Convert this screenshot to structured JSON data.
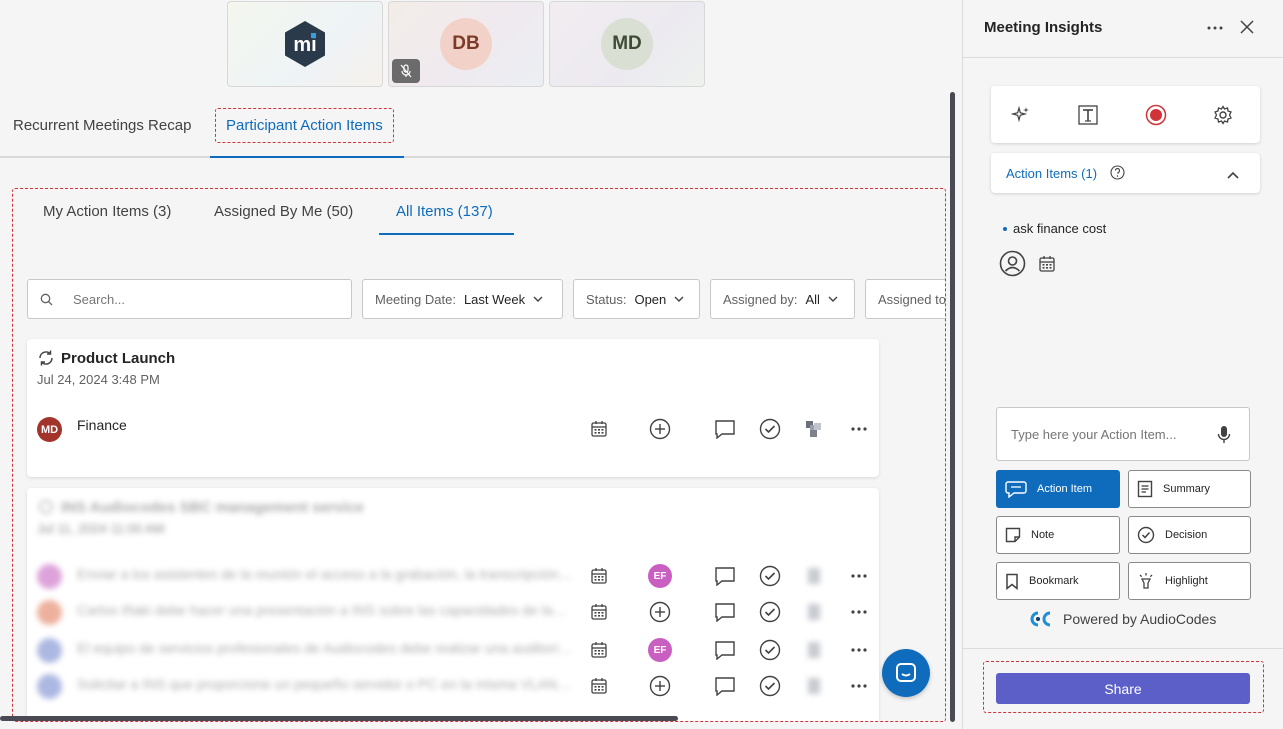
{
  "participants": {
    "tile2_initials": "DB",
    "tile3_initials": "MD"
  },
  "top_tabs": {
    "recap": "Recurrent Meetings Recap",
    "participant_items": "Participant Action Items"
  },
  "sub_tabs": {
    "mine": "My Action Items (3)",
    "assigned_by_me": "Assigned By Me (50)",
    "all": "All Items (137)"
  },
  "filters": {
    "search_placeholder": "Search...",
    "meeting_date_label": "Meeting Date:",
    "meeting_date_value": "Last Week",
    "status_label": "Status:",
    "status_value": "Open",
    "assigned_by_label": "Assigned by:",
    "assigned_by_value": "All",
    "assigned_to_label": "Assigned to"
  },
  "cards": [
    {
      "title": "Product Launch",
      "date": "Jul 24, 2024 3:48 PM",
      "rows": [
        {
          "initials": "MD",
          "text": "Finance"
        }
      ]
    },
    {
      "title": "INS Audiocodes SBC management service",
      "date": "Jul 11, 2024 11:00 AM",
      "rows": [
        {
          "initials": "",
          "text": "Enviar a los asistentes de la reunión el acceso a la grabación, la transcripción…",
          "assignee": "EF"
        },
        {
          "initials": "",
          "text": "Carlos Iñaki debe hacer una presentación a INS sobre las capacidades de la…",
          "assignee": ""
        },
        {
          "initials": "",
          "text": "El equipo de servicios profesionales de Audiocodes debe realizar una auditorí…",
          "assignee": "EF"
        },
        {
          "initials": "",
          "text": "Solicitar a INS que proporcione un pequeño servidor o PC en la misma VLAN…",
          "assignee": ""
        }
      ]
    }
  ],
  "panel": {
    "title": "Meeting Insights",
    "action_items_header": "Action Items (1)",
    "item_text": "ask finance cost",
    "type_placeholder": "Type here your Action Item...",
    "buttons": {
      "action_item": "Action Item",
      "summary": "Summary",
      "note": "Note",
      "decision": "Decision",
      "bookmark": "Bookmark",
      "highlight": "Highlight"
    },
    "powered_by": "Powered by AudioCodes",
    "share": "Share"
  },
  "colors": {
    "accent": "#0f6cbd",
    "share": "#5b5fc7",
    "record": "#d13438"
  }
}
